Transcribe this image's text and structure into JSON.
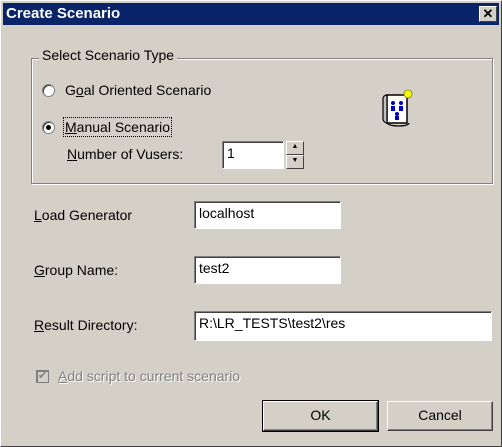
{
  "window": {
    "title": "Create Scenario"
  },
  "scenario_type": {
    "legend": "Select Scenario Type",
    "goal_oriented": {
      "label_pre": "G",
      "label_key": "o",
      "label_post": "al Oriented Scenario",
      "selected": false
    },
    "manual": {
      "label_pre": "",
      "label_key": "M",
      "label_post": "anual Scenario",
      "selected": true
    },
    "vusers": {
      "label_key": "N",
      "label_post": "umber of Vusers:",
      "value": "1"
    }
  },
  "fields": {
    "load_generator": {
      "label_key": "L",
      "label_post": "oad Generator",
      "value": "localhost"
    },
    "group_name": {
      "label_key": "G",
      "label_post": "roup Name:",
      "value": "test2"
    },
    "result_directory": {
      "label_key": "R",
      "label_post": "esult Directory:",
      "value": "R:\\LR_TESTS\\test2\\res"
    }
  },
  "add_script": {
    "label_key": "A",
    "label_post": "dd script to current scenario",
    "checked": true,
    "enabled": false
  },
  "buttons": {
    "ok": "OK",
    "cancel": "Cancel"
  },
  "icons": {
    "close": "close-icon",
    "scenario": "scenario-document-icon"
  }
}
